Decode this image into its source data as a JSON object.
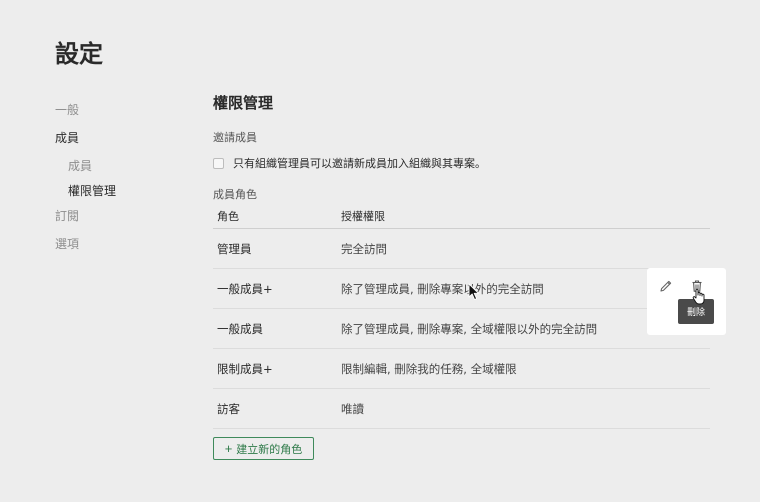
{
  "page": {
    "title": "設定"
  },
  "sidebar": {
    "items": [
      {
        "label": "一般"
      },
      {
        "label": "成員"
      },
      {
        "label": "成員"
      },
      {
        "label": "權限管理"
      },
      {
        "label": "訂閱"
      },
      {
        "label": "選項"
      }
    ]
  },
  "permissions": {
    "title": "權限管理",
    "invite_label": "邀請成員",
    "invite_checkbox_label": "只有組織管理員可以邀請新成員加入組織與其專案。",
    "invite_checkbox_checked": false,
    "roles_label": "成員角色",
    "columns": {
      "role": "角色",
      "permission": "授權權限"
    },
    "rows": [
      {
        "role": "管理員",
        "permission": "完全訪問"
      },
      {
        "role": "一般成員+",
        "permission": "除了管理成員, 刪除專案以外的完全訪問"
      },
      {
        "role": "一般成員",
        "permission": "除了管理成員, 刪除專案, 全域權限以外的完全訪問"
      },
      {
        "role": "限制成員+",
        "permission": "限制編輯, 刪除我的任務, 全域權限"
      },
      {
        "role": "訪客",
        "permission": "唯讀"
      }
    ],
    "create_button": {
      "icon": "plus-icon",
      "label": "建立新的角色"
    }
  },
  "row_actions": {
    "edit_icon": "pencil-icon",
    "delete_icon": "trash-icon",
    "tooltip": "刪除"
  },
  "colors": {
    "accent": "#2e7a49",
    "background": "#ededed"
  }
}
